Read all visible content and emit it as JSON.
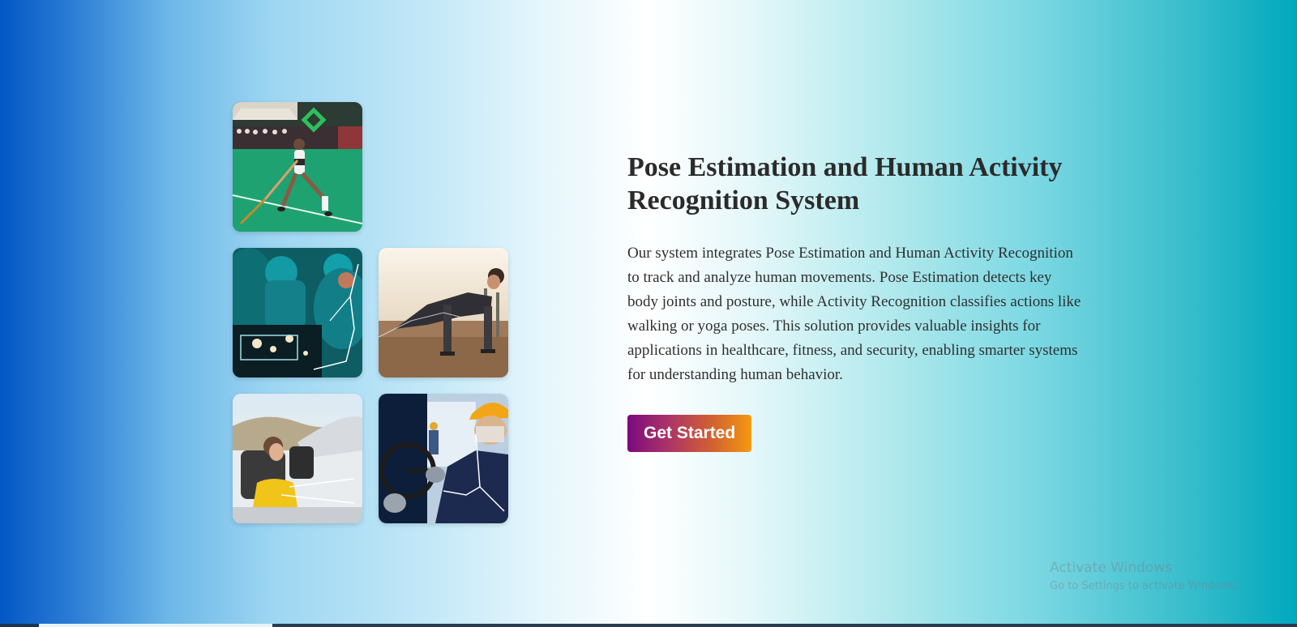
{
  "hero": {
    "title": "Pose Estimation and Human Activity Recognition System",
    "description": "Our system integrates Pose Estimation and Human Activity Recognition to track and analyze human movements. Pose Estimation detects key body joints and posture, while Activity Recognition classifies actions like walking or yoga poses. This solution provides valuable insights for applications in healthcare, fitness, and security, enabling smarter systems for understanding human behavior.",
    "cta_label": "Get Started"
  },
  "gallery": {
    "images": [
      {
        "icon": "field-hockey-player-image"
      },
      {
        "icon": "surgeons-operating-image"
      },
      {
        "icon": "man-doing-plank-exercise-image"
      },
      {
        "icon": "woman-driving-convertible-image"
      },
      {
        "icon": "worker-with-hardhat-driving-image"
      }
    ]
  },
  "watermark": {
    "title": "Activate Windows",
    "subtitle": "Go to Settings to activate Windows."
  },
  "colors": {
    "gradient_left": "#0257c4",
    "gradient_center": "#ffffff",
    "gradient_right": "#00a8bd",
    "button_start": "#7b0a7e",
    "button_end": "#f49a12",
    "title_text": "#2b2b2b"
  }
}
